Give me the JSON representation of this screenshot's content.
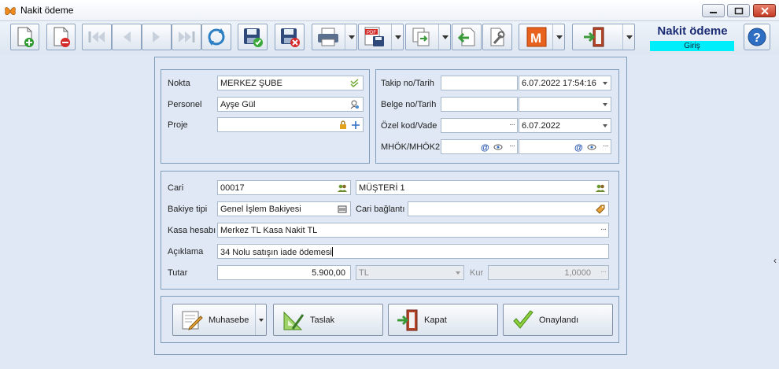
{
  "window": {
    "title": "Nakit ödeme"
  },
  "header": {
    "title": "Nakit ödeme",
    "badge": "Giriş",
    "badge_color": "#00eefa"
  },
  "toolbar": {
    "buttons": [
      {
        "name": "new",
        "icon": "new-document-icon"
      },
      {
        "name": "delete",
        "icon": "delete-document-icon"
      },
      {
        "name": "first",
        "icon": "first-record-icon"
      },
      {
        "name": "previous",
        "icon": "previous-record-icon"
      },
      {
        "name": "next",
        "icon": "next-record-icon"
      },
      {
        "name": "last",
        "icon": "last-record-icon"
      },
      {
        "name": "refresh",
        "icon": "refresh-icon"
      },
      {
        "name": "save",
        "icon": "save-icon"
      },
      {
        "name": "save-cancel",
        "icon": "save-cancel-icon"
      },
      {
        "name": "print",
        "icon": "printer-icon"
      },
      {
        "name": "export-pdf",
        "icon": "pdf-icon",
        "label": "PDF"
      },
      {
        "name": "copy",
        "icon": "copy-icon"
      },
      {
        "name": "import",
        "icon": "import-icon"
      },
      {
        "name": "settings",
        "icon": "wrench-icon"
      },
      {
        "name": "module",
        "icon": "m-icon",
        "label": "M"
      },
      {
        "name": "exit",
        "icon": "exit-door-icon"
      }
    ]
  },
  "top_left": {
    "nokta_label": "Nokta",
    "nokta_value": "MERKEZ ŞUBE",
    "personel_label": "Personel",
    "personel_value": "Ayşe Gül",
    "proje_label": "Proje",
    "proje_value": ""
  },
  "top_right": {
    "takip_label": "Takip no/Tarih",
    "takip_no": "",
    "takip_tarih": "6.07.2022 17:54:16",
    "belge_label": "Belge no/Tarih",
    "belge_no": "",
    "belge_tarih": ". .       : :",
    "ozel_label": "Özel kod/Vade",
    "ozel_kod": "",
    "vade": "6.07.2022",
    "mhok_label": "MHÖK/MHÖK2",
    "mhok1": "",
    "mhok2": ""
  },
  "middle": {
    "cari_label": "Cari",
    "cari_kod": "00017",
    "cari_ad": "MÜŞTERİ 1",
    "bakiye_label": "Bakiye tipi",
    "bakiye_value": "Genel İşlem Bakiyesi",
    "cari_baglanti_label": "Cari bağlantı",
    "cari_baglanti_value": "",
    "kasa_label": "Kasa hesabı",
    "kasa_value": "Merkez TL Kasa Nakit TL",
    "aciklama_label": "Açıklama",
    "aciklama_value": "34 Nolu satışın iade ödemesi",
    "tutar_label": "Tutar",
    "tutar_value": "5.900,00",
    "currency_value": "TL",
    "kur_label": "Kur",
    "kur_value": "1,0000"
  },
  "actions": {
    "muhasebe": "Muhasebe",
    "taslak": "Taslak",
    "kapat": "Kapat",
    "onaylandi": "Onaylandı"
  }
}
